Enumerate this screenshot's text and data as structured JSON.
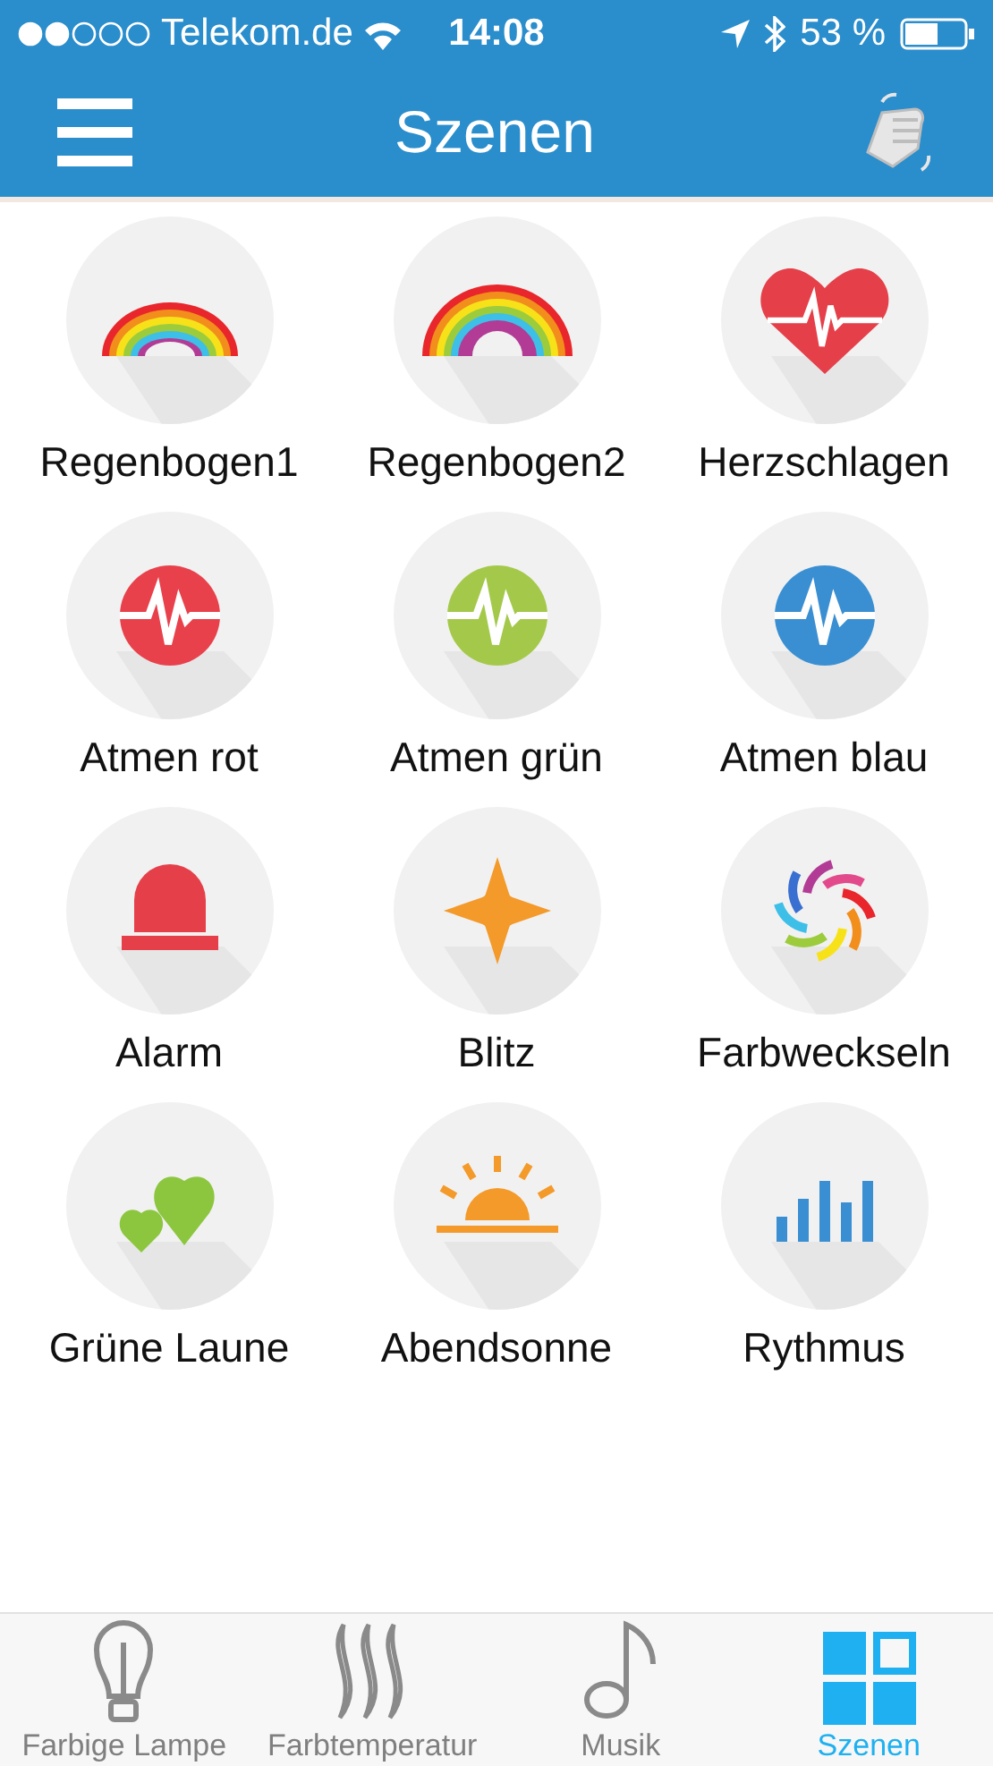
{
  "status_bar": {
    "carrier": "Telekom.de",
    "time": "14:08",
    "battery": "53 %"
  },
  "header": {
    "title": "Szenen"
  },
  "scenes": [
    {
      "label": "Regenbogen1",
      "kind": "rainbow"
    },
    {
      "label": "Regenbogen2",
      "kind": "rainbow2"
    },
    {
      "label": "Herzschlagen",
      "kind": "heart"
    },
    {
      "label": "Atmen rot",
      "kind": "pulse",
      "color": "#e8414b"
    },
    {
      "label": "Atmen grün",
      "kind": "pulse",
      "color": "#a4c94a"
    },
    {
      "label": "Atmen blau",
      "kind": "pulse",
      "color": "#3a8fd2"
    },
    {
      "label": "Alarm",
      "kind": "alarm"
    },
    {
      "label": "Blitz",
      "kind": "star"
    },
    {
      "label": "Farbweckseln",
      "kind": "swirl"
    },
    {
      "label": "Grüne Laune",
      "kind": "hearts"
    },
    {
      "label": "Abendsonne",
      "kind": "sunset"
    },
    {
      "label": "Rythmus",
      "kind": "bars"
    }
  ],
  "tabs": [
    {
      "label": "Farbige Lampe",
      "kind": "bulb",
      "selected": false
    },
    {
      "label": "Farbtemperatur",
      "kind": "flame",
      "selected": false
    },
    {
      "label": "Musik",
      "kind": "note",
      "selected": false
    },
    {
      "label": "Szenen",
      "kind": "grid",
      "selected": true
    }
  ]
}
